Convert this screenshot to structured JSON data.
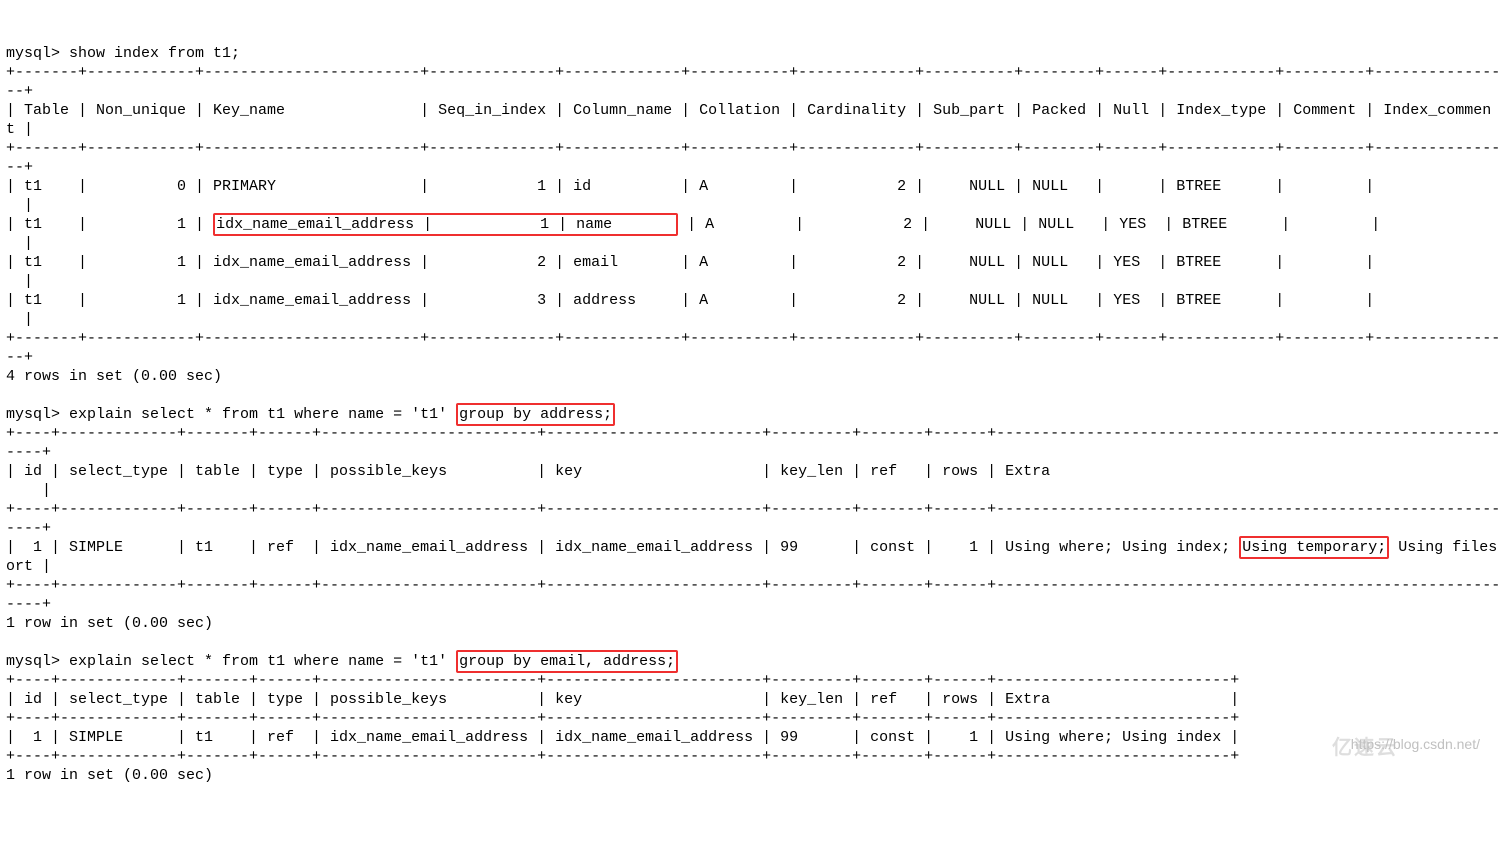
{
  "prompt": "mysql>",
  "cmd1": "show index from t1;",
  "sep1a": "+-------+------------+------------------------+--------------+-------------+-----------+-------------+----------+--------+------+------------+---------+--------------",
  "sep1b": "--+",
  "hdr1": "| Table | Non_unique | Key_name               | Seq_in_index | Column_name | Collation | Cardinality | Sub_part | Packed | Null | Index_type | Comment | Index_commen",
  "hdr1b": "t |",
  "row1": "| t1    |          0 | PRIMARY                |            1 | id          | A         |           2 |     NULL | NULL   |      | BTREE      |         |             ",
  "row1b": "  |",
  "row2_pre": "| t1    |          1 |",
  "row2_box": "idx_name_email_address |            1 | name       ",
  "row2_post": " | A         |           2 |     NULL | NULL   | YES  | BTREE      |         |             ",
  "row3_pre": "| t1    |          1 | ",
  "row3_mid": "idx_name_email_address |            2 | email      ",
  "row3_post": " | A         |           2 |     NULL | NULL   | YES  | BTREE      |         |             ",
  "row4_pre": "| t1    |          1 | ",
  "row4_mid": "idx_name_email_address |            3 | address    ",
  "row4_post": " | A         |           2 |     NULL | NULL   | YES  | BTREE      |         |             ",
  "rows1_footer": "4 rows in set (0.00 sec)",
  "cmd2_pre": "explain select * from t1 where name = 't1' ",
  "cmd2_box": "group by address;",
  "sep2a": "+----+-------------+-------+------+------------------------+------------------------+---------+-------+------+-----------------------------------------------------------",
  "sep2b": "----+",
  "hdr2": "| id | select_type | table | type | possible_keys          | key                    | key_len | ref   | rows | Extra                                                     ",
  "hdr2b": "    |",
  "row5_pre": "|  1 | SIMPLE      | t1    | ref  | idx_name_email_address | idx_name_email_address | 99      | const |    1 | Using where; Using index; ",
  "row5_box": "Using temporary;",
  "row5_post": " Using files",
  "row5b": "ort |",
  "rows2_footer": "1 row in set (0.00 sec)",
  "cmd3_pre": "explain select * from t1 where name = 't1' ",
  "cmd3_box": "group by email, address;",
  "sep3": "+----+-------------+-------+------+------------------------+------------------------+---------+-------+------+--------------------------+",
  "hdr3": "| id | select_type | table | type | possible_keys          | key                    | key_len | ref   | rows | Extra                    |",
  "row6": "|  1 | SIMPLE      | t1    | ref  | idx_name_email_address | idx_name_email_address | 99      | const |    1 | Using where; Using index |",
  "rows3_footer": "1 row in set (0.00 sec)",
  "watermark_url": "https://blog.csdn.net/",
  "watermark_brand": "亿速云",
  "chart_data": {
    "type": "table",
    "tables": [
      {
        "title": "SHOW INDEX FROM t1",
        "columns": [
          "Table",
          "Non_unique",
          "Key_name",
          "Seq_in_index",
          "Column_name",
          "Collation",
          "Cardinality",
          "Sub_part",
          "Packed",
          "Null",
          "Index_type",
          "Comment",
          "Index_comment"
        ],
        "rows": [
          [
            "t1",
            0,
            "PRIMARY",
            1,
            "id",
            "A",
            2,
            null,
            null,
            "",
            "BTREE",
            "",
            ""
          ],
          [
            "t1",
            1,
            "idx_name_email_address",
            1,
            "name",
            "A",
            2,
            null,
            null,
            "YES",
            "BTREE",
            "",
            ""
          ],
          [
            "t1",
            1,
            "idx_name_email_address",
            2,
            "email",
            "A",
            2,
            null,
            null,
            "YES",
            "BTREE",
            "",
            ""
          ],
          [
            "t1",
            1,
            "idx_name_email_address",
            3,
            "address",
            "A",
            2,
            null,
            null,
            "YES",
            "BTREE",
            "",
            ""
          ]
        ]
      },
      {
        "title": "EXPLAIN select * from t1 where name='t1' group by address",
        "columns": [
          "id",
          "select_type",
          "table",
          "type",
          "possible_keys",
          "key",
          "key_len",
          "ref",
          "rows",
          "Extra"
        ],
        "rows": [
          [
            1,
            "SIMPLE",
            "t1",
            "ref",
            "idx_name_email_address",
            "idx_name_email_address",
            99,
            "const",
            1,
            "Using where; Using index; Using temporary; Using filesort"
          ]
        ]
      },
      {
        "title": "EXPLAIN select * from t1 where name='t1' group by email, address",
        "columns": [
          "id",
          "select_type",
          "table",
          "type",
          "possible_keys",
          "key",
          "key_len",
          "ref",
          "rows",
          "Extra"
        ],
        "rows": [
          [
            1,
            "SIMPLE",
            "t1",
            "ref",
            "idx_name_email_address",
            "idx_name_email_address",
            99,
            "const",
            1,
            "Using where; Using index"
          ]
        ]
      }
    ]
  }
}
